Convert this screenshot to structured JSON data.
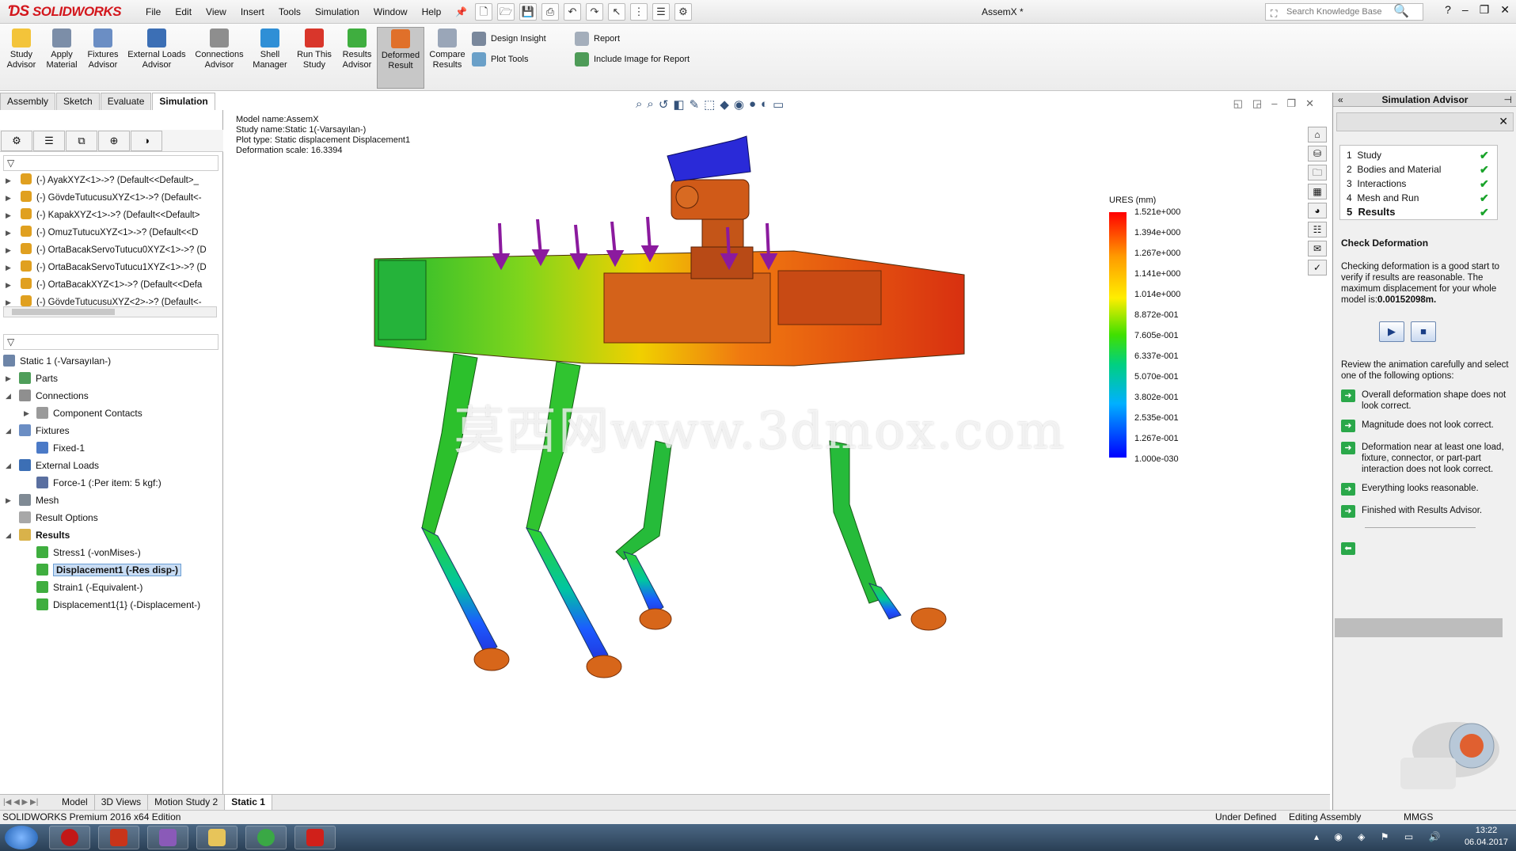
{
  "app": {
    "logo": "SOLIDWORKS",
    "menus": [
      "File",
      "Edit",
      "View",
      "Insert",
      "Tools",
      "Simulation",
      "Window",
      "Help"
    ],
    "document_title": "AssemX *",
    "search_placeholder": "Search Knowledge Base"
  },
  "ribbon": {
    "buttons": [
      {
        "label": "Study Advisor"
      },
      {
        "label": "Apply Material"
      },
      {
        "label": "Fixtures Advisor"
      },
      {
        "label": "External Loads Advisor"
      },
      {
        "label": "Connections Advisor"
      },
      {
        "label": "Shell Manager"
      },
      {
        "label": "Run This Study"
      },
      {
        "label": "Results Advisor"
      },
      {
        "label": "Deformed Result"
      },
      {
        "label": "Compare Results"
      }
    ],
    "design_insight": "Design Insight",
    "plot_tools": "Plot Tools",
    "report": "Report",
    "include_image": "Include Image for Report"
  },
  "cm_tabs": [
    "Assembly",
    "Sketch",
    "Evaluate",
    "Simulation"
  ],
  "parts": [
    "(-) AyakXYZ<1>->? (Default<<Default>_",
    "(-) GövdeTutucusuXYZ<1>->? (Default<-",
    "(-) KapakXYZ<1>->? (Default<<Default>",
    "(-) OmuzTutucuXYZ<1>->? (Default<<D",
    "(-) OrtaBacakServoTutucu0XYZ<1>->? (D",
    "(-) OrtaBacakServoTutucu1XYZ<1>->? (D",
    "(-) OrtaBacakXYZ<1>->? (Default<<Defa",
    "(-) GövdeTutucusuXYZ<2>->? (Default<-"
  ],
  "tree": {
    "study": "Static 1 (-Varsayılan-)",
    "parts": "Parts",
    "connections": "Connections",
    "component_contacts": "Component Contacts",
    "fixtures": "Fixtures",
    "fixed1": "Fixed-1",
    "external_loads": "External Loads",
    "force1": "Force-1 (:Per item: 5 kgf:)",
    "mesh": "Mesh",
    "result_options": "Result Options",
    "results": "Results",
    "stress1": "Stress1 (-vonMises-)",
    "displacement1": "Displacement1 (-Res disp-)",
    "strain1": "Strain1 (-Equivalent-)",
    "displacement1_1": "Displacement1{1} (-Displacement-)"
  },
  "plot_info": {
    "model_name": "Model name:AssemX",
    "study_name": "Study name:Static 1(-Varsayılan-)",
    "plot_type": "Plot type: Static displacement Displacement1",
    "deformation_scale": "Deformation scale: 16.3394"
  },
  "legend": {
    "title": "URES (mm)",
    "values": [
      "1.521e+000",
      "1.394e+000",
      "1.267e+000",
      "1.141e+000",
      "1.014e+000",
      "8.872e-001",
      "7.605e-001",
      "6.337e-001",
      "5.070e-001",
      "3.802e-001",
      "2.535e-001",
      "1.267e-001",
      "1.000e-030"
    ]
  },
  "watermark": "莫西网www.3dmox.com",
  "advisor": {
    "title": "Simulation Advisor",
    "steps": [
      {
        "num": "1",
        "label": "Study"
      },
      {
        "num": "2",
        "label": "Bodies and Material"
      },
      {
        "num": "3",
        "label": "Interactions"
      },
      {
        "num": "4",
        "label": "Mesh and Run"
      },
      {
        "num": "5",
        "label": "Results"
      }
    ],
    "heading": "Check Deformation",
    "intro": "Checking deformation is a good start to verify if results are reasonable. The maximum displacement for your whole model is:",
    "max_disp": "0.00152098m.",
    "review": "Review the animation carefully and select one of the following options:",
    "options": [
      "Overall deformation shape does not look correct.",
      "Magnitude does not look correct.",
      "Deformation near at least one load, fixture, connector, or part-part interaction does not look correct.",
      "Everything looks reasonable.",
      "Finished with Results Advisor."
    ]
  },
  "bottom_tabs": [
    "Model",
    "3D Views",
    "Motion Study 2",
    "Static 1"
  ],
  "status": {
    "edition": "SOLIDWORKS Premium 2016 x64 Edition",
    "state1": "Under Defined",
    "state2": "Editing Assembly",
    "units": "MMGS"
  },
  "taskbar": {
    "time": "13:22",
    "date": "06.04.2017"
  },
  "colors": {
    "accent": "#d3161c",
    "check": "#19a32a",
    "load_arrow": "#8b1a9e"
  }
}
